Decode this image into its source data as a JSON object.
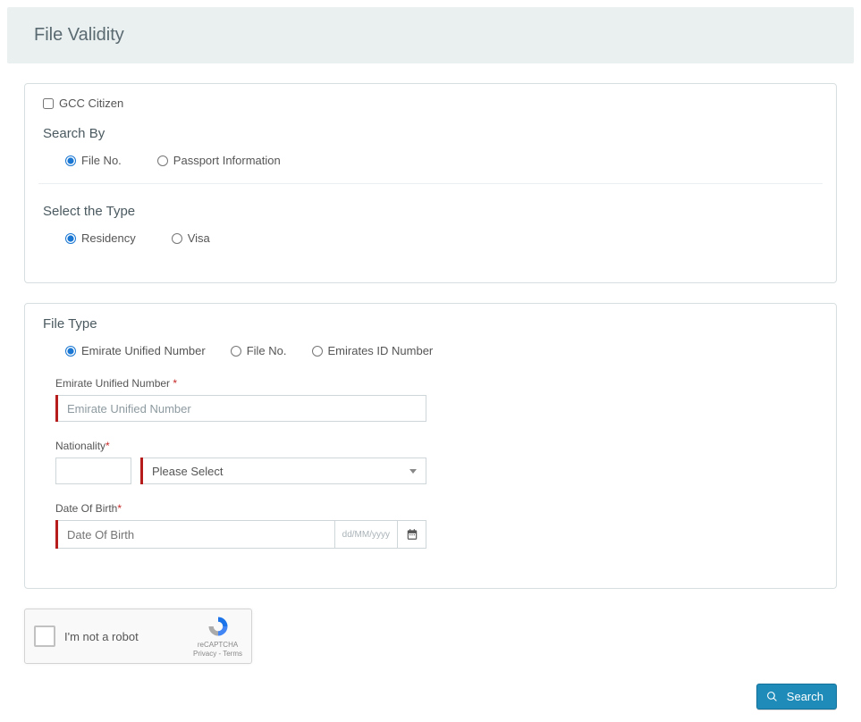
{
  "header": {
    "title": "File Validity"
  },
  "gcc": {
    "label": "GCC Citizen",
    "checked": false
  },
  "searchBy": {
    "title": "Search By",
    "options": {
      "file_no": "File No.",
      "passport": "Passport Information"
    },
    "selected": "file_no"
  },
  "selectType": {
    "title": "Select the Type",
    "options": {
      "residency": "Residency",
      "visa": "Visa"
    },
    "selected": "residency"
  },
  "fileType": {
    "title": "File Type",
    "options": {
      "eun": "Emirate Unified Number",
      "file_no": "File No.",
      "eid": "Emirates ID Number"
    },
    "selected": "eun"
  },
  "fields": {
    "eun": {
      "label": "Emirate Unified Number",
      "placeholder": "Emirate Unified Number",
      "value": ""
    },
    "nationality": {
      "label": "Nationality",
      "placeholder": "Please Select",
      "value": ""
    },
    "dob": {
      "label": "Date Of Birth",
      "placeholder": "Date Of Birth",
      "format": "dd/MM/yyyy",
      "value": ""
    }
  },
  "recaptcha": {
    "label": "I'm not a robot",
    "brand": "reCAPTCHA",
    "links": "Privacy - Terms"
  },
  "actions": {
    "search": "Search"
  },
  "required_marker": "*"
}
